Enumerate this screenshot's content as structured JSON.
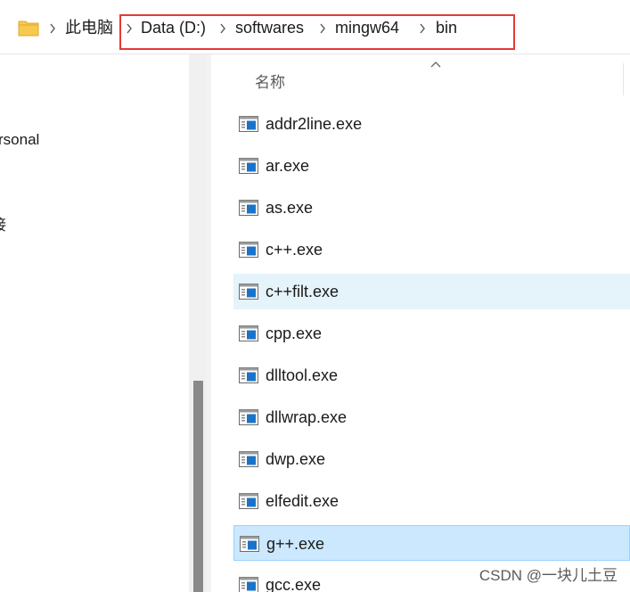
{
  "breadcrumb": {
    "items": [
      "此电脑",
      "Data (D:)",
      "softwares",
      "mingw64",
      "bin"
    ]
  },
  "nav": {
    "items": [
      "rsonal",
      "接"
    ]
  },
  "filelist": {
    "column_name": "名称",
    "files": [
      "addr2line.exe",
      "ar.exe",
      "as.exe",
      "c++.exe",
      "c++filt.exe",
      "cpp.exe",
      "dlltool.exe",
      "dllwrap.exe",
      "dwp.exe",
      "elfedit.exe",
      "g++.exe",
      "gcc.exe"
    ],
    "hover_index": 4,
    "selected_index": 10
  },
  "watermark": "CSDN @一块儿土豆",
  "colors": {
    "highlight_box": "#e53935",
    "hover_row": "#e5f3fb",
    "selected_row": "#cce8ff",
    "folder": "#f8c94c"
  }
}
